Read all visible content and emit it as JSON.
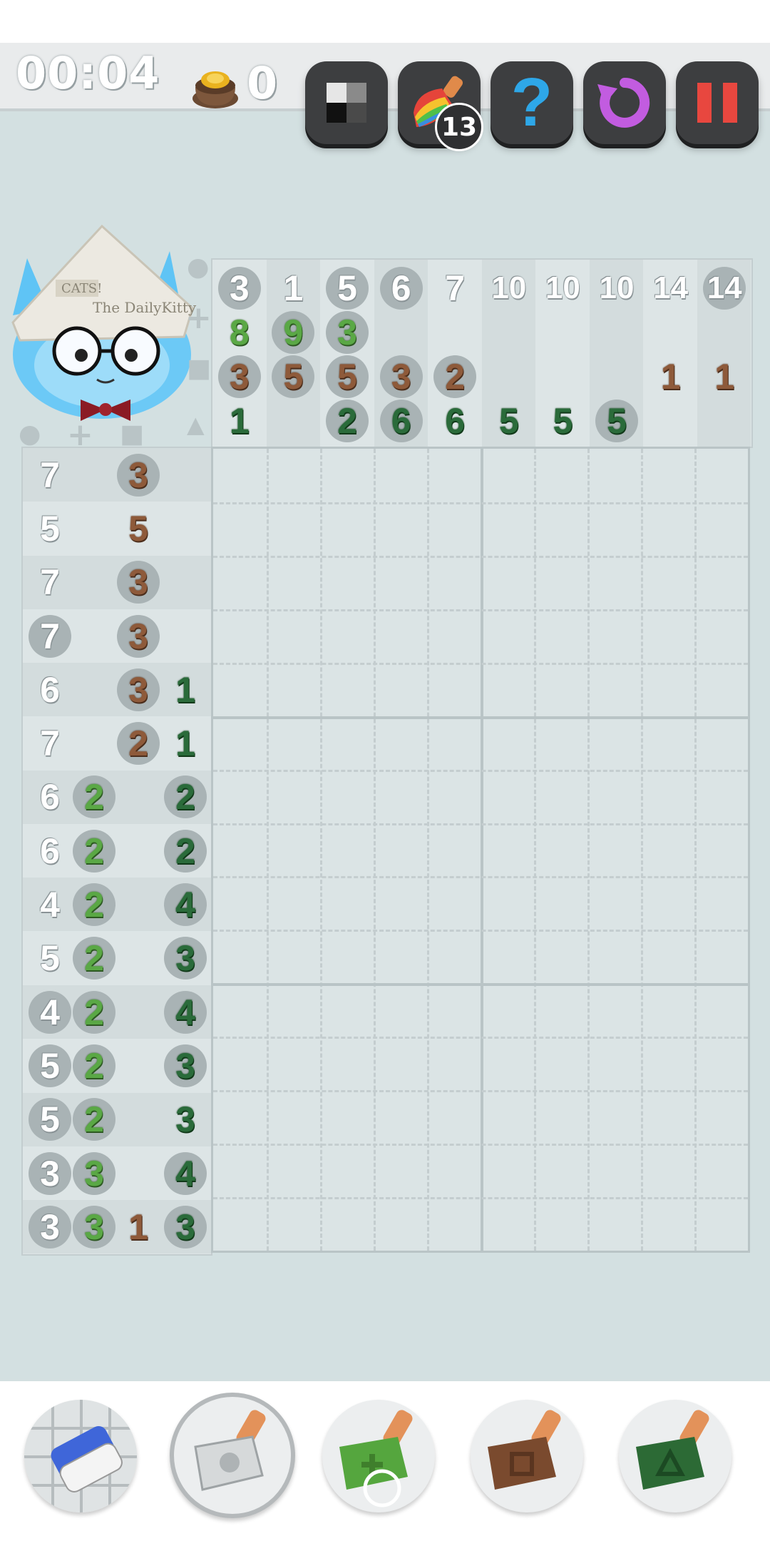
{
  "header": {
    "timer": "00:04",
    "coins": "0",
    "buttons": [
      {
        "name": "toggle-view-button",
        "icon": "grayscale-tiles-icon"
      },
      {
        "name": "paint-hint-button",
        "icon": "rainbow-brush-icon",
        "badge": "13"
      },
      {
        "name": "help-button",
        "icon": "question-mark-icon",
        "glyph": "?"
      },
      {
        "name": "restart-button",
        "icon": "restart-arrow-icon"
      },
      {
        "name": "pause-button",
        "icon": "pause-icon"
      }
    ]
  },
  "shape_legend": {
    "circle": "●",
    "plus": "+",
    "square": "■",
    "triangle": "▲"
  },
  "column_clues": [
    [
      {
        "v": "3",
        "c": "white",
        "circ": true
      },
      {
        "v": "8",
        "c": "lg"
      },
      {
        "v": "3",
        "c": "br",
        "circ": true
      },
      {
        "v": "1",
        "c": "dg"
      }
    ],
    [
      {
        "v": "1",
        "c": "white"
      },
      {
        "v": "9",
        "c": "lg",
        "circ": true
      },
      {
        "v": "5",
        "c": "br",
        "circ": true
      }
    ],
    [
      {
        "v": "5",
        "c": "white",
        "circ": true
      },
      {
        "v": "3",
        "c": "lg",
        "circ": true
      },
      {
        "v": "5",
        "c": "br",
        "circ": true
      },
      {
        "v": "2",
        "c": "dg",
        "circ": true
      }
    ],
    [
      {
        "v": "6",
        "c": "white",
        "circ": true
      },
      {
        "v": "3",
        "c": "br",
        "circ": true
      },
      {
        "v": "6",
        "c": "dg",
        "circ": true
      }
    ],
    [
      {
        "v": "7",
        "c": "white"
      },
      {
        "v": "2",
        "c": "br",
        "circ": true
      },
      {
        "v": "6",
        "c": "dg"
      }
    ],
    [
      {
        "v": "10",
        "c": "white"
      },
      {
        "v": "5",
        "c": "dg"
      }
    ],
    [
      {
        "v": "10",
        "c": "white"
      },
      {
        "v": "5",
        "c": "dg"
      }
    ],
    [
      {
        "v": "10",
        "c": "white"
      },
      {
        "v": "5",
        "c": "dg",
        "circ": true
      }
    ],
    [
      {
        "v": "14",
        "c": "white"
      },
      {
        "v": "1",
        "c": "br"
      }
    ],
    [
      {
        "v": "14",
        "c": "white",
        "circ": true
      },
      {
        "v": "1",
        "c": "br"
      }
    ]
  ],
  "row_clues": [
    [
      {
        "v": "7",
        "c": "white"
      },
      {
        "v": "3",
        "c": "br",
        "circ": true
      }
    ],
    [
      {
        "v": "5",
        "c": "white"
      },
      {
        "v": "5",
        "c": "br"
      }
    ],
    [
      {
        "v": "7",
        "c": "white"
      },
      {
        "v": "3",
        "c": "br",
        "circ": true
      }
    ],
    [
      {
        "v": "7",
        "c": "white",
        "circ": true
      },
      {
        "v": "3",
        "c": "br",
        "circ": true
      }
    ],
    [
      {
        "v": "6",
        "c": "white"
      },
      {
        "v": "3",
        "c": "br",
        "circ": true
      },
      {
        "v": "1",
        "c": "dg"
      }
    ],
    [
      {
        "v": "7",
        "c": "white"
      },
      {
        "v": "2",
        "c": "br",
        "circ": true
      },
      {
        "v": "1",
        "c": "dg"
      }
    ],
    [
      {
        "v": "6",
        "c": "white"
      },
      {
        "v": "2",
        "c": "lg",
        "circ": true
      },
      {
        "v": "2",
        "c": "dg",
        "circ": true
      }
    ],
    [
      {
        "v": "6",
        "c": "white"
      },
      {
        "v": "2",
        "c": "lg",
        "circ": true
      },
      {
        "v": "2",
        "c": "dg",
        "circ": true
      }
    ],
    [
      {
        "v": "4",
        "c": "white"
      },
      {
        "v": "2",
        "c": "lg",
        "circ": true
      },
      {
        "v": "4",
        "c": "dg",
        "circ": true
      }
    ],
    [
      {
        "v": "5",
        "c": "white"
      },
      {
        "v": "2",
        "c": "lg",
        "circ": true
      },
      {
        "v": "3",
        "c": "dg",
        "circ": true
      }
    ],
    [
      {
        "v": "4",
        "c": "white",
        "circ": true
      },
      {
        "v": "2",
        "c": "lg",
        "circ": true
      },
      {
        "v": "4",
        "c": "dg",
        "circ": true
      }
    ],
    [
      {
        "v": "5",
        "c": "white",
        "circ": true
      },
      {
        "v": "2",
        "c": "lg",
        "circ": true
      },
      {
        "v": "3",
        "c": "dg",
        "circ": true
      }
    ],
    [
      {
        "v": "5",
        "c": "white",
        "circ": true
      },
      {
        "v": "2",
        "c": "lg",
        "circ": true
      },
      {
        "v": "3",
        "c": "dg"
      }
    ],
    [
      {
        "v": "3",
        "c": "white",
        "circ": true
      },
      {
        "v": "3",
        "c": "lg",
        "circ": true
      },
      {
        "v": "4",
        "c": "dg",
        "circ": true
      }
    ],
    [
      {
        "v": "3",
        "c": "white",
        "circ": true
      },
      {
        "v": "3",
        "c": "lg",
        "circ": true
      },
      {
        "v": "1",
        "c": "br"
      },
      {
        "v": "3",
        "c": "dg",
        "circ": true
      }
    ]
  ],
  "tools": [
    {
      "name": "eraser-tool",
      "icon": "eraser-icon"
    },
    {
      "name": "white-brush-tool",
      "icon": "white-brush-icon",
      "selected": true
    },
    {
      "name": "lightgreen-brush-tool",
      "icon": "green-plus-brush-icon"
    },
    {
      "name": "brown-brush-tool",
      "icon": "brown-square-brush-icon"
    },
    {
      "name": "darkgreen-brush-tool",
      "icon": "darkgreen-triangle-brush-icon"
    }
  ],
  "colors": {
    "white": "#ffffff",
    "lg": "#5aa845",
    "br": "#8e5a3a",
    "dg": "#2a6b3a",
    "background": "#d3e0e1"
  },
  "mascot": {
    "hat_text_1": "CATS!",
    "hat_text_2": "The DailyKitty"
  }
}
